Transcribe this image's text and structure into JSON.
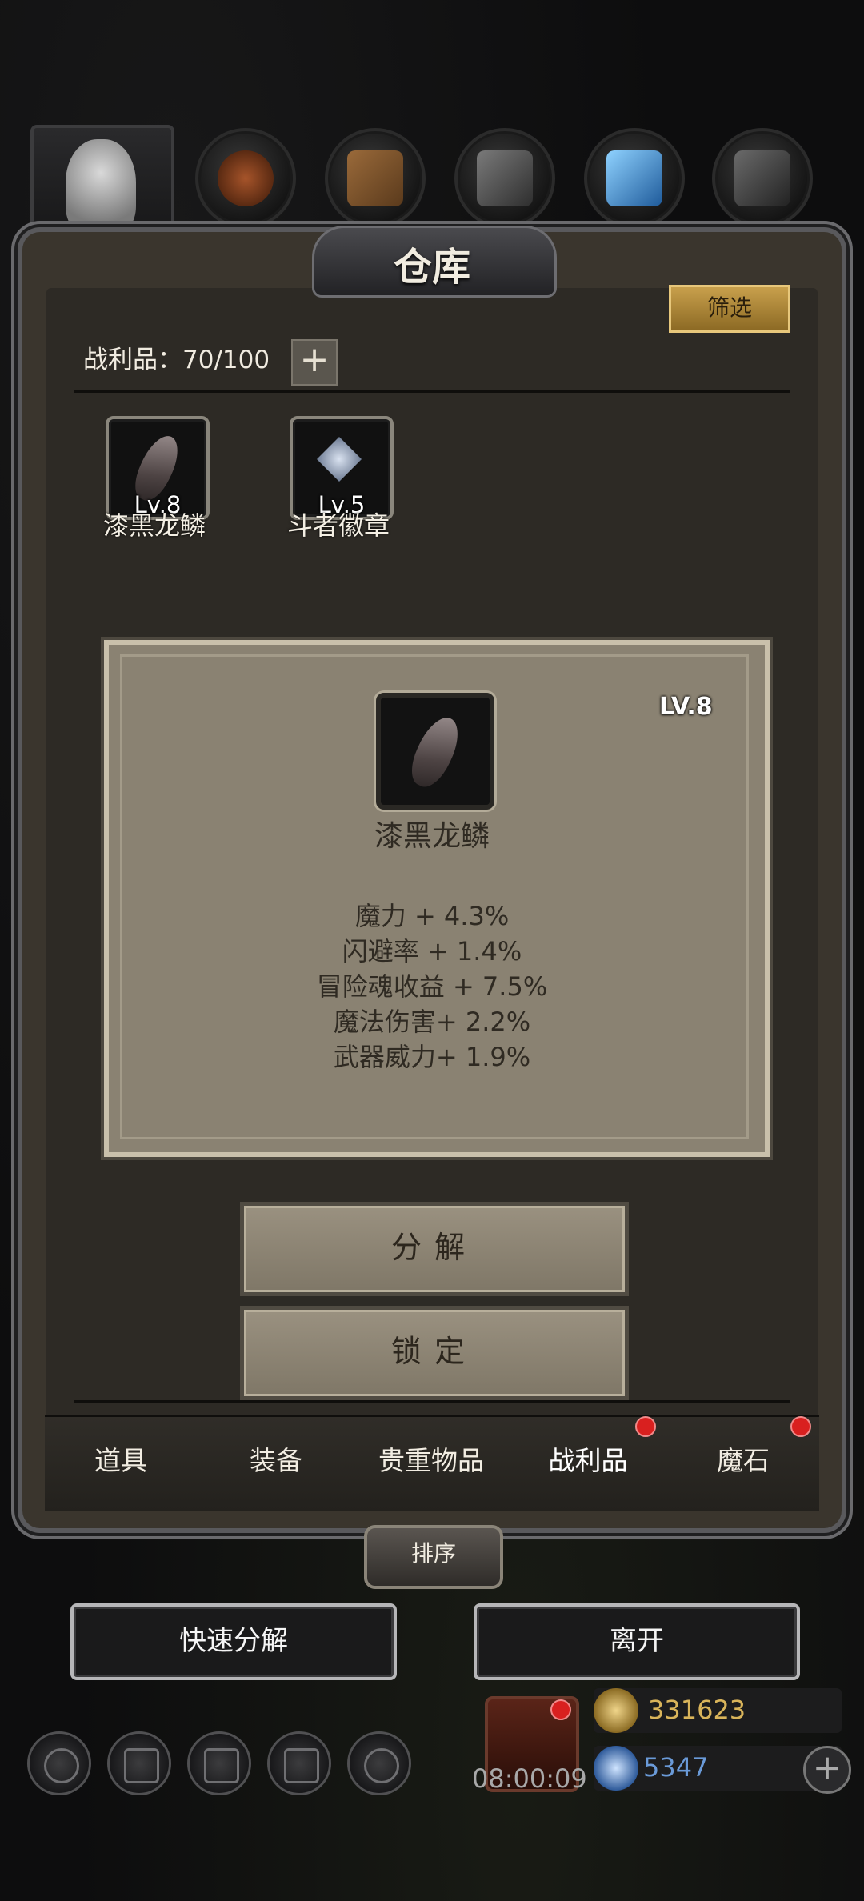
{
  "window": {
    "title": "仓库"
  },
  "header": {
    "filter_label": "筛选",
    "counter_label": "战利品：70/100",
    "add_label": "+"
  },
  "items": [
    {
      "name": "漆黑龙鳞",
      "level": "Lv.8",
      "icon": "dragon-scale-icon"
    },
    {
      "name": "斗者徽章",
      "level": "Lv.5",
      "icon": "fighter-badge-icon"
    }
  ],
  "detail": {
    "level": "LV.8",
    "name": "漆黑龙鳞",
    "icon": "dragon-scale-icon",
    "stats": [
      "魔力 + 4.3%",
      "闪避率 + 1.4%",
      "冒险魂收益 + 7.5%",
      "魔法伤害+ 2.2%",
      "武器威力+ 1.9%"
    ]
  },
  "actions": {
    "decompose": "分解",
    "lock": "锁定"
  },
  "tabs": [
    {
      "label": "道具",
      "badge": false
    },
    {
      "label": "装备",
      "badge": false
    },
    {
      "label": "贵重物品",
      "badge": false
    },
    {
      "label": "战利品",
      "badge": true,
      "active": true
    },
    {
      "label": "魔石",
      "badge": true
    }
  ],
  "sort_label": "排序",
  "bottom": {
    "quick_decompose": "快速分解",
    "leave": "离开"
  },
  "footer": {
    "timer": "08:00:09",
    "gold": "331623",
    "gems": "5347",
    "gold_color": "#d9b45a",
    "gem_color": "#6a9ad8"
  },
  "colors": {
    "accent_gold": "#c8a04c",
    "badge_red": "#d9201f",
    "card_bg": "#8a8272"
  }
}
